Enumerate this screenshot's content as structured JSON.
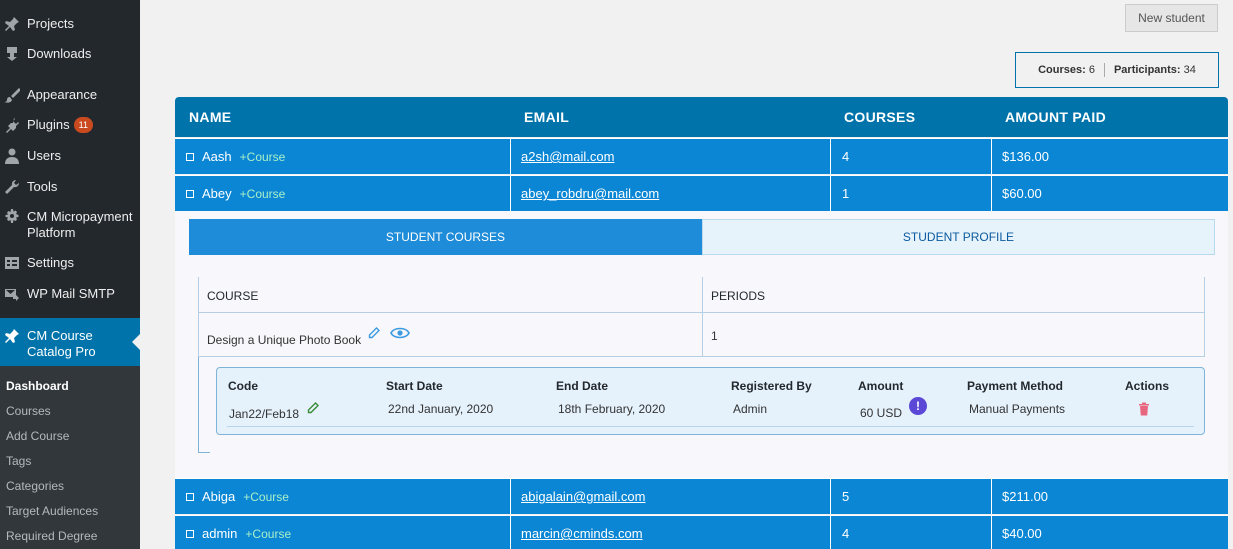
{
  "sidebar": {
    "items": [
      {
        "label": "Projects",
        "icon": "pin-icon"
      },
      {
        "label": "Downloads",
        "icon": "download-pin-icon"
      },
      {
        "label": "Appearance",
        "icon": "brush-icon"
      },
      {
        "label": "Plugins",
        "icon": "plugin-icon",
        "badge": "11"
      },
      {
        "label": "Users",
        "icon": "user-icon"
      },
      {
        "label": "Tools",
        "icon": "wrench-icon"
      },
      {
        "label": "CM Micropayment Platform",
        "icon": "gear-icon"
      },
      {
        "label": "Settings",
        "icon": "settings-icon"
      },
      {
        "label": "WP Mail SMTP",
        "icon": "mail-icon"
      },
      {
        "label": "CM Course Catalog Pro",
        "icon": "pin-icon"
      }
    ],
    "submenu": [
      "Dashboard",
      "Courses",
      "Add Course",
      "Tags",
      "Categories",
      "Target Audiences",
      "Required Degree"
    ]
  },
  "toolbar": {
    "new_student_label": "New student"
  },
  "stats": {
    "courses_label": "Courses:",
    "courses_value": "6",
    "participants_label": "Participants:",
    "participants_value": "34"
  },
  "table": {
    "headers": [
      "NAME",
      "EMAIL",
      "COURSES",
      "AMOUNT PAID"
    ],
    "course_link_label": "+Course",
    "rows": [
      {
        "name": "Aash",
        "email": "a2sh@mail.com",
        "courses": "4",
        "amount": "$136.00"
      },
      {
        "name": "Abey",
        "email": "abey_robdru@mail.com",
        "courses": "1",
        "amount": "$60.00"
      },
      {
        "name": "Abiga",
        "email": "abigalain@gmail.com",
        "courses": "5",
        "amount": "$211.00"
      },
      {
        "name": "admin",
        "email": "marcin@cminds.com",
        "courses": "4",
        "amount": "$40.00"
      }
    ]
  },
  "detail": {
    "tabs": [
      "STUDENT COURSES",
      "STUDENT PROFILE"
    ],
    "course_table": {
      "headers": [
        "COURSE",
        "PERIODS"
      ],
      "course_name": "Design a Unique Photo Book",
      "periods": "1"
    },
    "period": {
      "headers": [
        "Code",
        "Start Date",
        "End Date",
        "Registered By",
        "Amount",
        "Payment Method",
        "Actions"
      ],
      "code": "Jan22/Feb18",
      "start_date": "22nd January, 2020",
      "end_date": "18th February, 2020",
      "registered_by": "Admin",
      "amount": "60 USD",
      "payment_method": "Manual Payments"
    }
  }
}
